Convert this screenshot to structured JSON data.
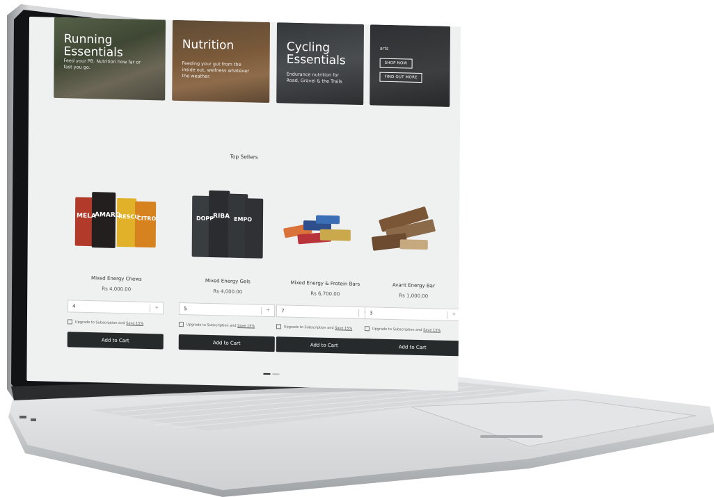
{
  "banners": [
    {
      "title": "Running Essentials",
      "desc": "Feed your PB. Nutrition how far or fast you go."
    },
    {
      "title": "Nutrition",
      "desc": "Feeding your gut from the inside out, wellness whatever the weather."
    },
    {
      "title": "Cycling Essentials",
      "desc": "Endurance nutrition for Road, Gravel & the Trails"
    },
    {
      "title": "",
      "desc": "arts",
      "btn_primary": "SHOP NOW",
      "btn_secondary": "FIND OUT MORE"
    }
  ],
  "section_title": "Top Sellers",
  "products": [
    {
      "name": "Mixed Energy Chews",
      "price": "Rs 4,000.00",
      "qty": "4",
      "plus": "+",
      "sub_text": "Upgrade to Subscription and ",
      "save": "Save 15%",
      "cart": "Add to Cart",
      "pkg_labels": [
        "MELA",
        "AMARO",
        "RESCU",
        "CITRO"
      ]
    },
    {
      "name": "Mixed Energy Gels",
      "price": "Rs 4,000.00",
      "qty": "5",
      "plus": "+",
      "sub_text": "Upgrade to Subscription and ",
      "save": "Save 15%",
      "cart": "Add to Cart",
      "pkg_labels": [
        "DOPP",
        "RIBA",
        "EMPO"
      ]
    },
    {
      "name": "Mixed Energy & Protein Bars",
      "price": "Rs 6,700.00",
      "qty": "7",
      "plus": "+",
      "sub_text": "Upgrade to Subscription and ",
      "save": "Save 15%",
      "cart": "Add to Cart"
    },
    {
      "name": "Avant Energy Bar",
      "price": "Rs 1,000.00",
      "qty": "3",
      "plus": "+",
      "sub_text": "Upgrade to Subscription and ",
      "save": "Save 15%",
      "cart": "Add to Cart"
    }
  ],
  "colors": {
    "cart_button": "#262a2b",
    "screen_bg": "#eff0f0",
    "laptop_silver": "#c9ccce"
  }
}
